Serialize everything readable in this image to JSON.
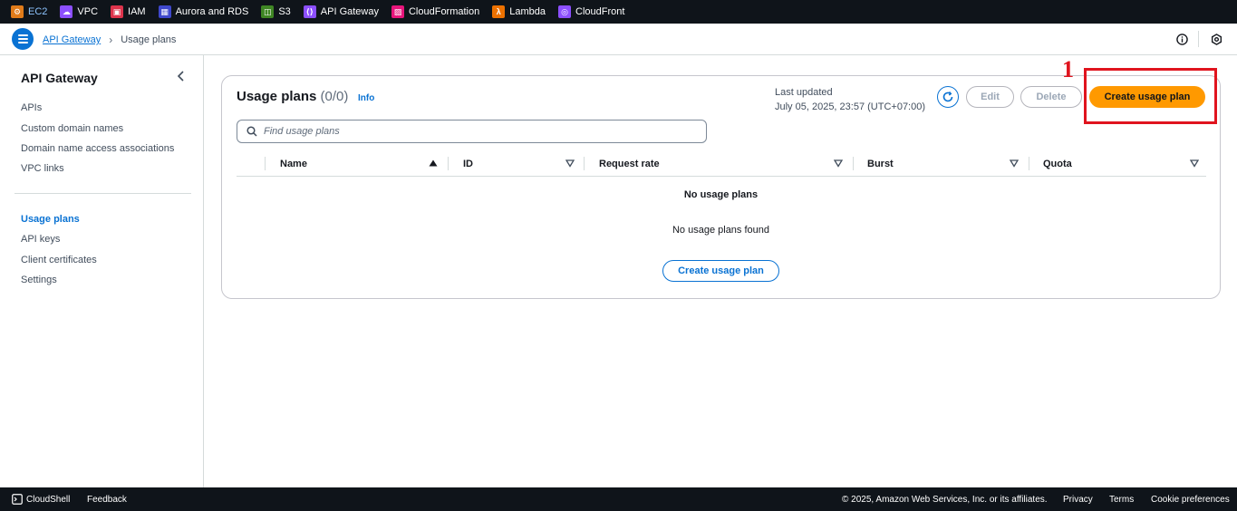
{
  "topbar": {
    "services": [
      {
        "label": "EC2",
        "color": "#e07b1a",
        "icon": "ec2-icon"
      },
      {
        "label": "VPC",
        "color": "#8c4fff",
        "icon": "vpc-icon"
      },
      {
        "label": "IAM",
        "color": "#dd344c",
        "icon": "iam-icon"
      },
      {
        "label": "Aurora and RDS",
        "color": "#3f48cc",
        "icon": "rds-icon"
      },
      {
        "label": "S3",
        "color": "#3f8624",
        "icon": "s3-icon"
      },
      {
        "label": "API Gateway",
        "color": "#8c4fff",
        "icon": "api-gateway-icon"
      },
      {
        "label": "CloudFormation",
        "color": "#e7157b",
        "icon": "cloudformation-icon"
      },
      {
        "label": "Lambda",
        "color": "#ed7100",
        "icon": "lambda-icon"
      },
      {
        "label": "CloudFront",
        "color": "#8c4fff",
        "icon": "cloudfront-icon"
      }
    ]
  },
  "header": {
    "breadcrumb_root": "API Gateway",
    "breadcrumb_current": "Usage plans"
  },
  "sidebar": {
    "title": "API Gateway",
    "group1": [
      "APIs",
      "Custom domain names",
      "Domain name access associations",
      "VPC links"
    ],
    "group2": [
      "Usage plans",
      "API keys",
      "Client certificates",
      "Settings"
    ],
    "active": "Usage plans"
  },
  "main": {
    "title": "Usage plans",
    "count": "(0/0)",
    "info": "Info",
    "last_updated_label": "Last updated",
    "last_updated_value": "July 05, 2025, 23:57 (UTC+07:00)",
    "edit_label": "Edit",
    "delete_label": "Delete",
    "create_label": "Create usage plan",
    "search_placeholder": "Find usage plans",
    "columns": [
      "Name",
      "ID",
      "Request rate",
      "Burst",
      "Quota"
    ],
    "empty_title": "No usage plans",
    "empty_subtitle": "No usage plans found",
    "empty_create_label": "Create usage plan"
  },
  "annotation": {
    "number": "1",
    "color": "#e0141e"
  },
  "footer": {
    "cloudshell": "CloudShell",
    "feedback": "Feedback",
    "copyright": "© 2025, Amazon Web Services, Inc. or its affiliates.",
    "privacy": "Privacy",
    "terms": "Terms",
    "cookie": "Cookie preferences"
  },
  "colors": {
    "accent": "#0972d3",
    "primary_button": "#ff9900",
    "nav_bg": "#0f141a"
  }
}
